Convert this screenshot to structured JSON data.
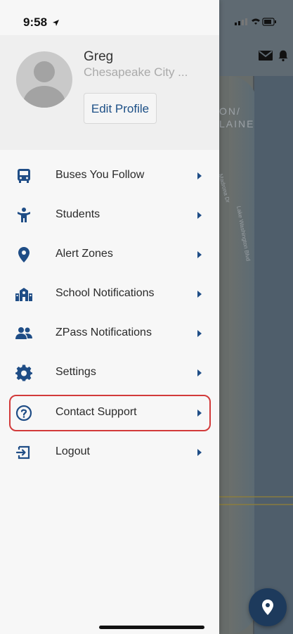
{
  "status_bar": {
    "time": "9:58"
  },
  "profile": {
    "name": "Greg",
    "organization": "Chesapeake City ...",
    "edit_button": "Edit Profile"
  },
  "menu": {
    "items": [
      {
        "label": "Buses You Follow",
        "icon": "bus-icon"
      },
      {
        "label": "Students",
        "icon": "student-icon"
      },
      {
        "label": "Alert Zones",
        "icon": "map-pin-icon"
      },
      {
        "label": "School Notifications",
        "icon": "school-icon"
      },
      {
        "label": "ZPass Notifications",
        "icon": "users-icon"
      },
      {
        "label": "Settings",
        "icon": "gear-icon"
      },
      {
        "label": "Contact Support",
        "icon": "question-circle-icon",
        "highlighted": true
      },
      {
        "label": "Logout",
        "icon": "logout-icon"
      }
    ]
  },
  "map": {
    "labels": [
      "ON/",
      "LAINE"
    ],
    "streets": [
      "Madrona Dr",
      "Lake Washington Blvd"
    ]
  },
  "colors": {
    "accent": "#1f4d86",
    "highlight_border": "#d23a3a",
    "fab": "#1d3a5c"
  }
}
